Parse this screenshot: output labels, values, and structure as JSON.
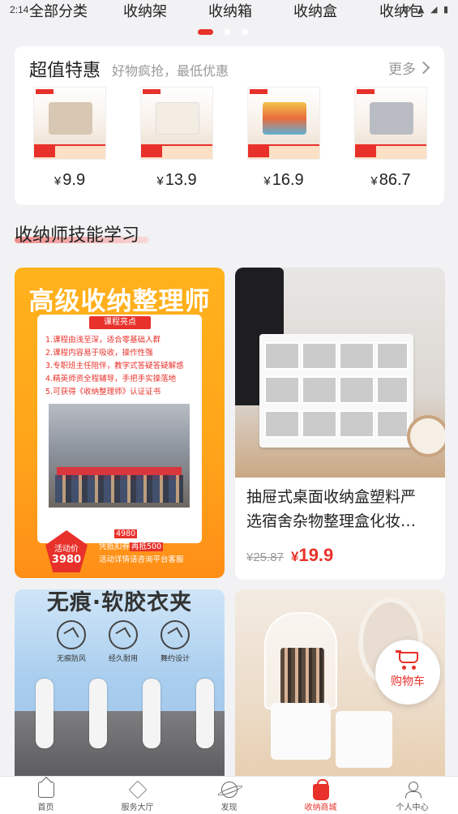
{
  "status_bar": {
    "time": "2:14",
    "icons": "⚙ ▲ ◢ ▮"
  },
  "category_tabs": [
    "全部分类",
    "收纳架",
    "收纳箱",
    "收纳盒",
    "收纳包"
  ],
  "carousel": {
    "pages": 3,
    "active": 0
  },
  "deals": {
    "title": "超值特惠",
    "subtitle": "好物疯抢，最低优惠",
    "more_label": "更多",
    "currency": "¥",
    "items": [
      {
        "price": "9.9"
      },
      {
        "price": "13.9"
      },
      {
        "price": "16.9"
      },
      {
        "price": "86.7"
      }
    ]
  },
  "section": {
    "title": "收纳师技能学习"
  },
  "promo": {
    "title": "高级收纳整理师",
    "box_head": "课程亮点",
    "points": [
      "1.课程由浅至深，适合零基础人群",
      "2.课程内容易于吸收，操作性强",
      "3.专职班主任陪伴，教学式答疑答疑解惑",
      "4.精英师资全程辅导，手把手实操落地",
      "5.可获得《收纳整理师》认证证书"
    ],
    "badge_line1": "活动价",
    "badge_line2": "3980",
    "line1_prefix": "原价",
    "line1_value": "4980",
    "line1_suffix": "，现在活动期间",
    "line2_prefix": "凭抵扣券",
    "line2_value": "再抵500",
    "line3": "活动详情请咨询平台客服"
  },
  "product": {
    "name_line1": "抽屉式桌面收纳盒塑料严",
    "name_line2": "选宿舍杂物整理盒化妆…",
    "old_price": "¥25.87",
    "currency": "¥",
    "new_price": "19.9"
  },
  "clip_card": {
    "title": "无痕·软胶衣夹",
    "features": [
      "无痕防风",
      "经久耐用",
      "舞约设计"
    ]
  },
  "cart_float": {
    "label": "购物车"
  },
  "tabbar": {
    "items": [
      {
        "label": "首页"
      },
      {
        "label": "服务大厅"
      },
      {
        "label": "发现"
      },
      {
        "label": "收纳商城"
      },
      {
        "label": "个人中心"
      }
    ],
    "active": 3
  },
  "colors": {
    "accent": "#e8312a",
    "promo_bg": "#ffa41a",
    "page_bg": "#f2f2f4"
  }
}
